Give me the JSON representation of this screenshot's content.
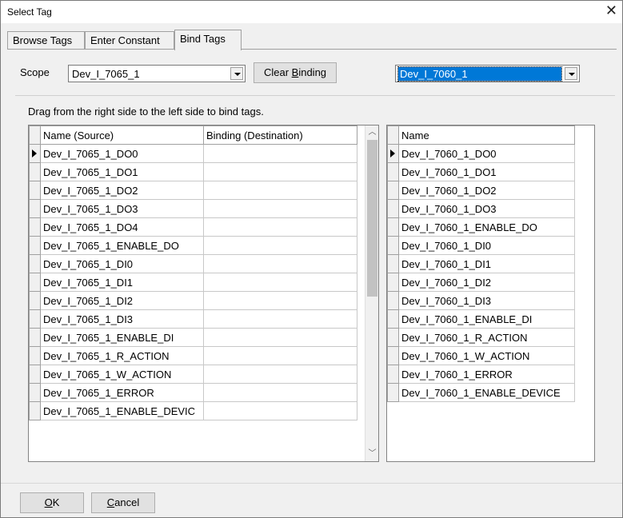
{
  "window": {
    "title": "Select Tag",
    "close_glyph": "✕"
  },
  "tabs": [
    {
      "label": "Browse Tags"
    },
    {
      "label": "Enter Constant"
    },
    {
      "label": "Bind Tags"
    }
  ],
  "scope": {
    "label": "Scope",
    "value": "Dev_I_7065_1",
    "clear_binding_pre": "Clear ",
    "clear_binding_hot": "B",
    "clear_binding_post": "inding"
  },
  "target_device": {
    "value": "Dev_I_7060_1"
  },
  "hint": "Drag from the right side to the left side to bind tags.",
  "source_grid": {
    "col_name": "Name (Source)",
    "col_binding": "Binding (Destination)",
    "rows": [
      {
        "name": "Dev_I_7065_1_DO0",
        "binding": ""
      },
      {
        "name": "Dev_I_7065_1_DO1",
        "binding": ""
      },
      {
        "name": "Dev_I_7065_1_DO2",
        "binding": ""
      },
      {
        "name": "Dev_I_7065_1_DO3",
        "binding": ""
      },
      {
        "name": "Dev_I_7065_1_DO4",
        "binding": ""
      },
      {
        "name": "Dev_I_7065_1_ENABLE_DO",
        "binding": ""
      },
      {
        "name": "Dev_I_7065_1_DI0",
        "binding": ""
      },
      {
        "name": "Dev_I_7065_1_DI1",
        "binding": ""
      },
      {
        "name": "Dev_I_7065_1_DI2",
        "binding": ""
      },
      {
        "name": "Dev_I_7065_1_DI3",
        "binding": ""
      },
      {
        "name": "Dev_I_7065_1_ENABLE_DI",
        "binding": ""
      },
      {
        "name": "Dev_I_7065_1_R_ACTION",
        "binding": ""
      },
      {
        "name": "Dev_I_7065_1_W_ACTION",
        "binding": ""
      },
      {
        "name": "Dev_I_7065_1_ERROR",
        "binding": ""
      },
      {
        "name": "Dev_I_7065_1_ENABLE_DEVIC",
        "binding": ""
      }
    ]
  },
  "dest_grid": {
    "col_name": "Name",
    "rows": [
      "Dev_I_7060_1_DO0",
      "Dev_I_7060_1_DO1",
      "Dev_I_7060_1_DO2",
      "Dev_I_7060_1_DO3",
      "Dev_I_7060_1_ENABLE_DO",
      "Dev_I_7060_1_DI0",
      "Dev_I_7060_1_DI1",
      "Dev_I_7060_1_DI2",
      "Dev_I_7060_1_DI3",
      "Dev_I_7060_1_ENABLE_DI",
      "Dev_I_7060_1_R_ACTION",
      "Dev_I_7060_1_W_ACTION",
      "Dev_I_7060_1_ERROR",
      "Dev_I_7060_1_ENABLE_DEVICE"
    ]
  },
  "footer": {
    "ok_hot": "O",
    "ok_post": "K",
    "cancel_hot": "C",
    "cancel_post": "ancel"
  }
}
